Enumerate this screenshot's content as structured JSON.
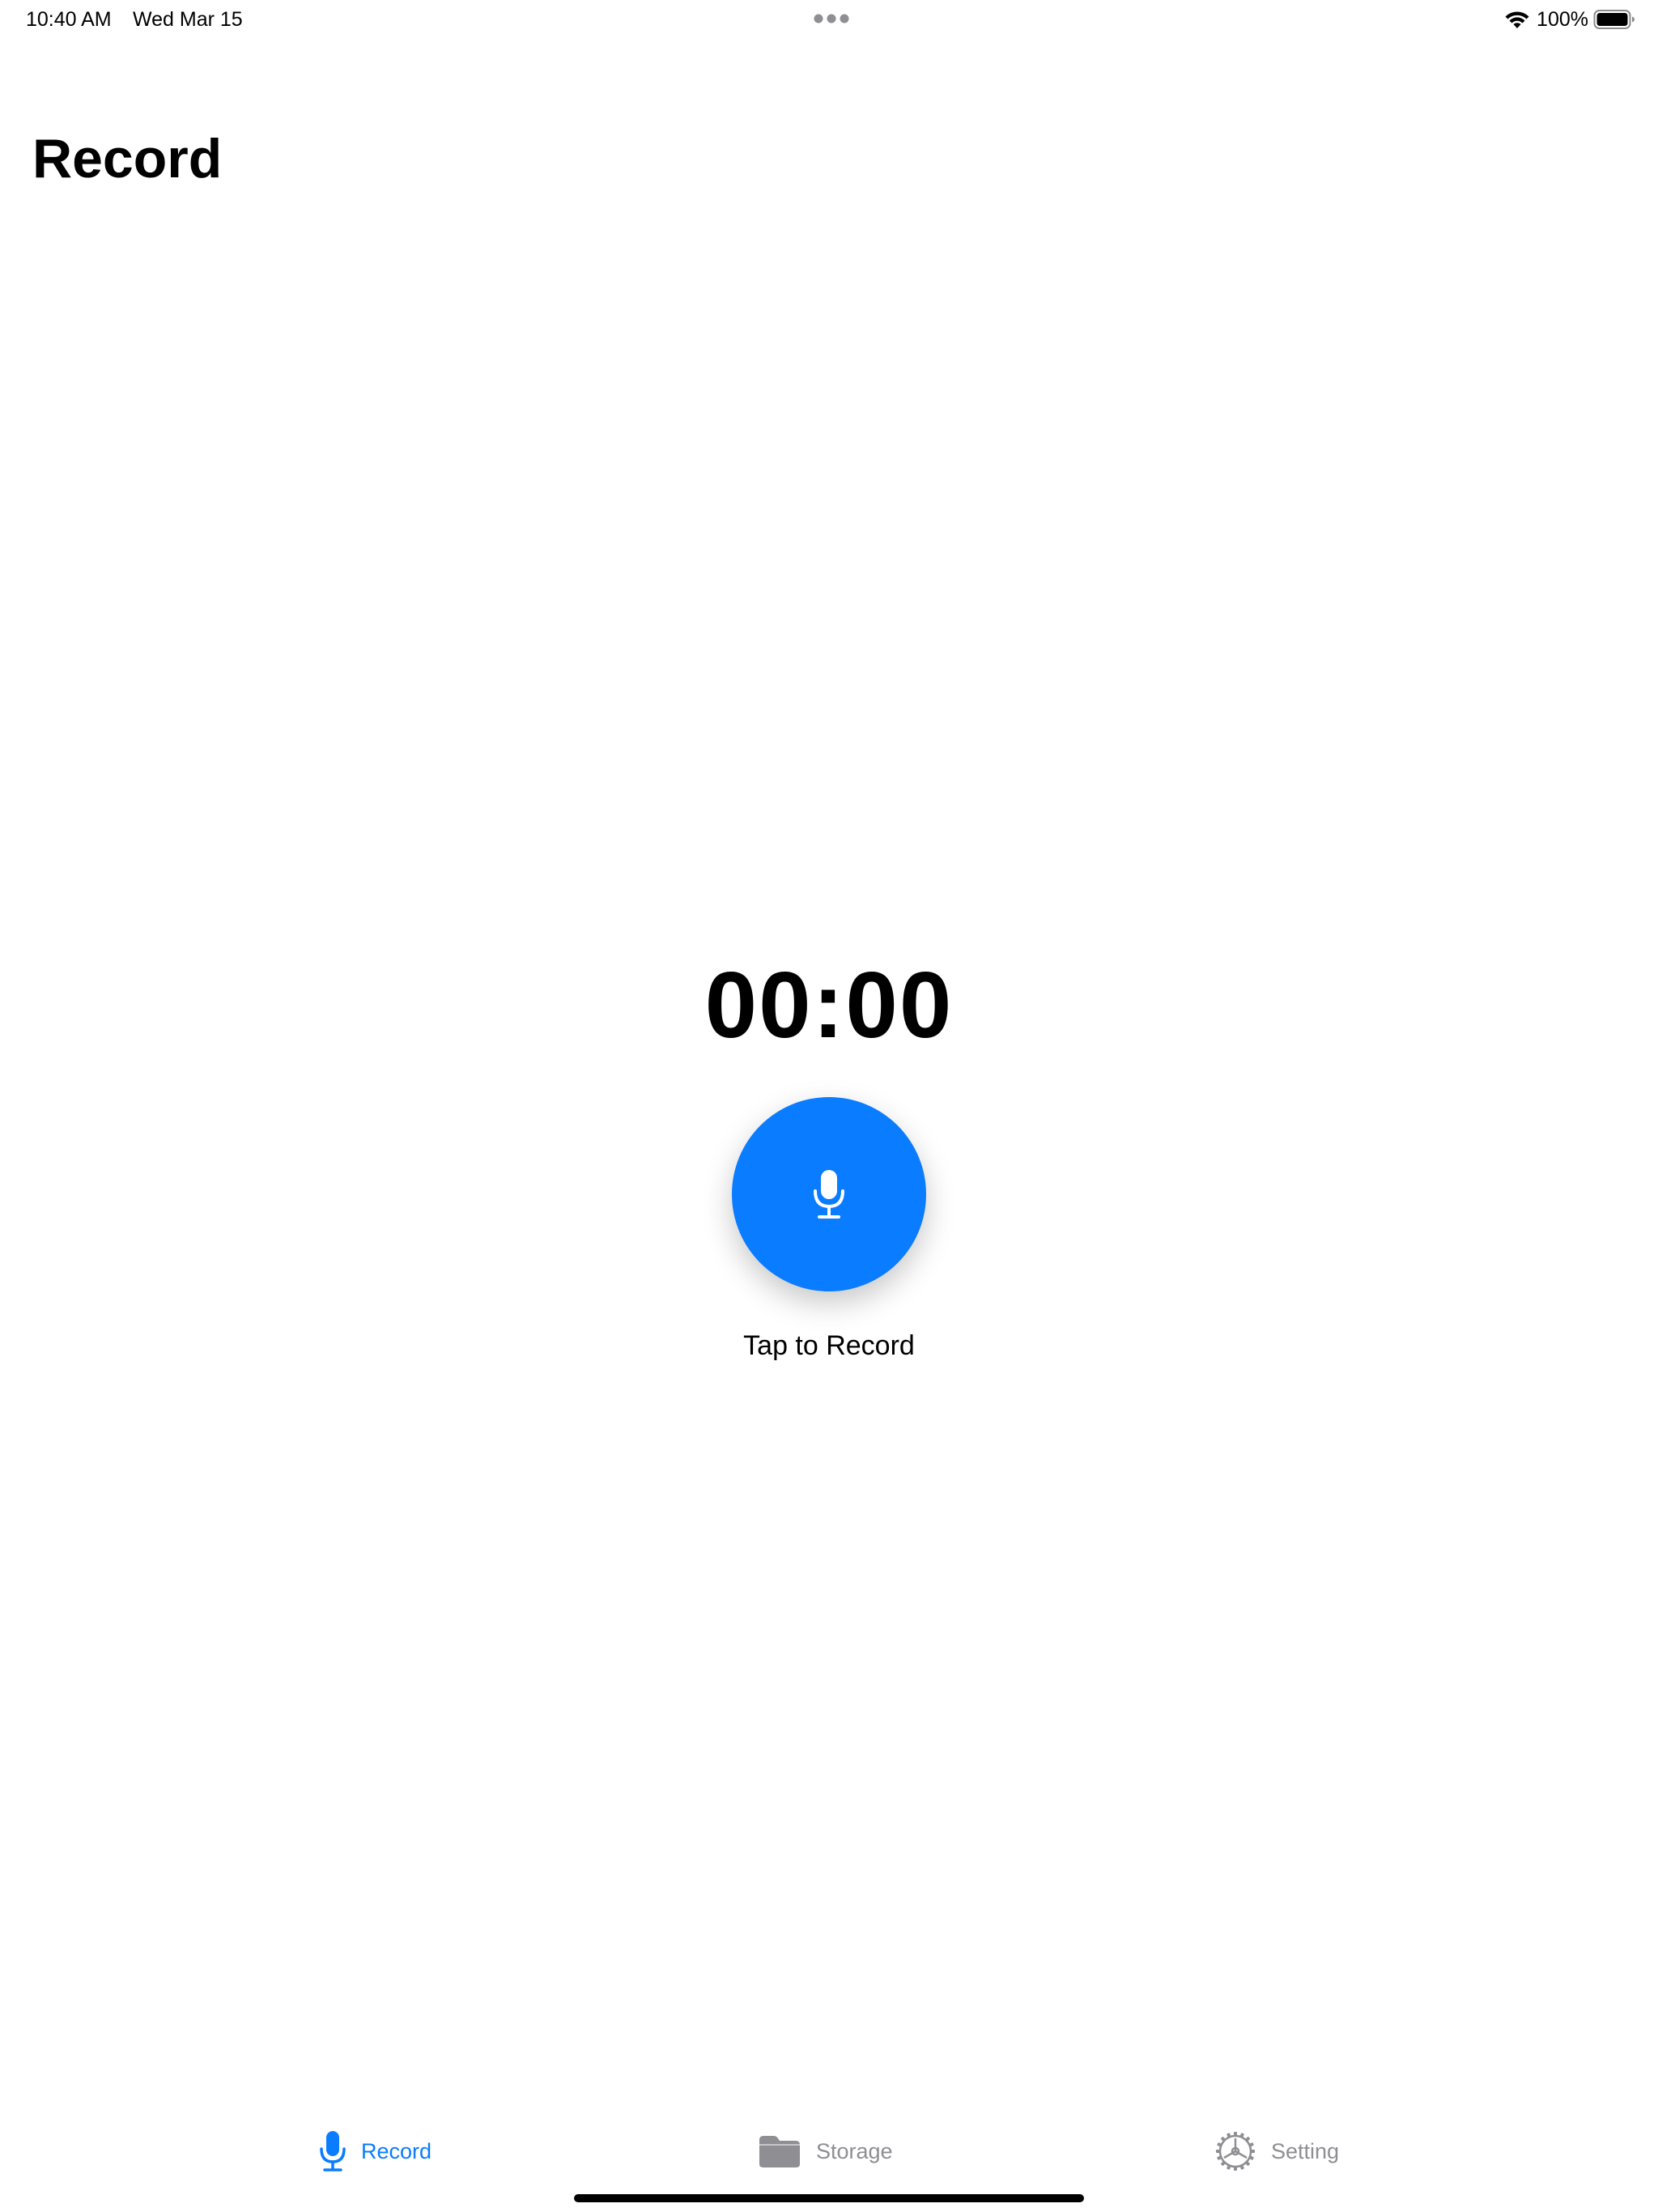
{
  "status_bar": {
    "time": "10:40 AM",
    "date": "Wed Mar 15",
    "battery": "100%",
    "icons": [
      "wifi-icon",
      "battery-icon",
      "multitask-dots-icon"
    ]
  },
  "header": {
    "title": "Record"
  },
  "recorder": {
    "timer": "00:00",
    "hint": "Tap to Record",
    "button_icon": "mic-icon"
  },
  "tab_bar": {
    "tabs": [
      {
        "label": "Record",
        "icon": "mic-icon",
        "active": true
      },
      {
        "label": "Storage",
        "icon": "folder-icon",
        "active": false
      },
      {
        "label": "Setting",
        "icon": "gear-icon",
        "active": false
      }
    ]
  },
  "colors": {
    "accent": "#0a7cff",
    "inactive": "#8e8e93",
    "text": "#000000",
    "background": "#ffffff"
  }
}
